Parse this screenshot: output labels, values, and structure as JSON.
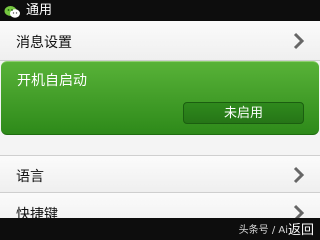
{
  "header": {
    "title": "通用",
    "app_icon": "wechat-icon"
  },
  "settings": {
    "notify_label": "消息设置",
    "startup_label": "开机自启动",
    "startup_state": "未启用",
    "language_label": "语言",
    "shortcut_label": "快捷键"
  },
  "footer": {
    "watermark": "头条号 / Ai",
    "back_label": "返回"
  },
  "colors": {
    "accent": "#3f9c28",
    "bar": "#0d0d0d"
  }
}
